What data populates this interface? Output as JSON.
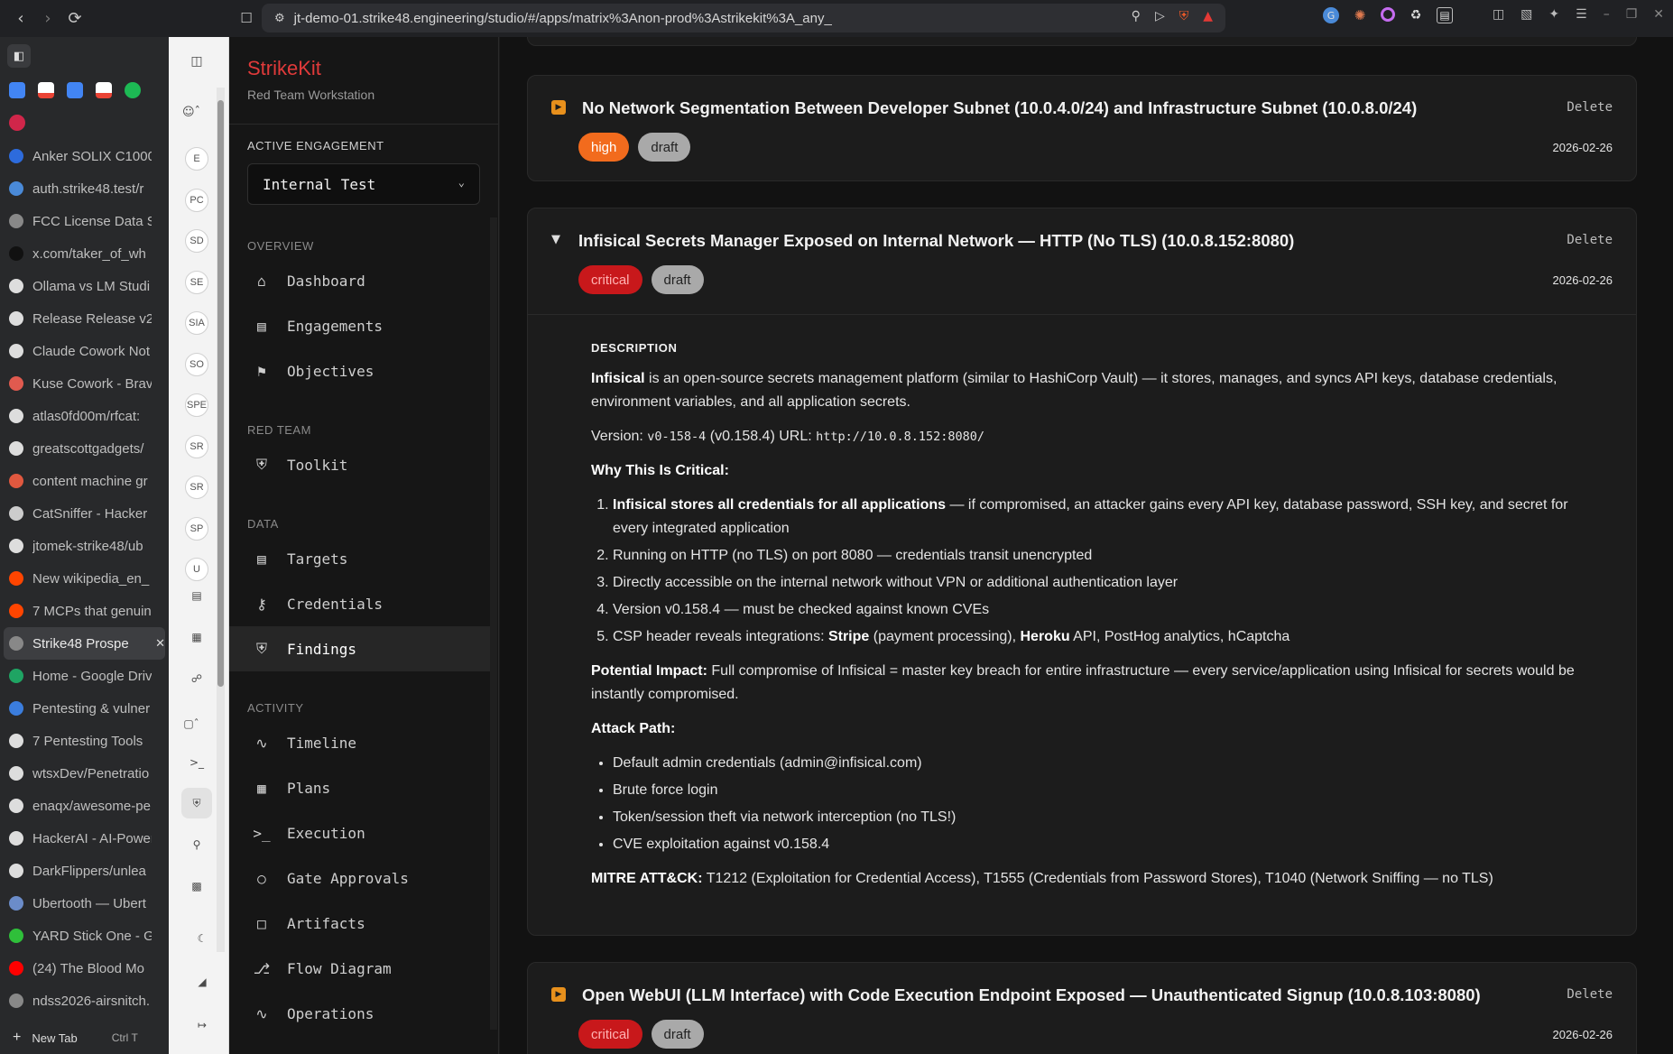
{
  "browser": {
    "url": "jt-demo-01.strike48.engineering/studio/#/apps/matrix%3Anon-prod%3Astrikekit%3A_any_",
    "new_tab_label": "New Tab",
    "new_tab_shortcut": "Ctrl  T"
  },
  "tabs": [
    {
      "label": "Anker SOLIX C1000",
      "color": "#2d6bdc"
    },
    {
      "label": "auth.strike48.test/r",
      "color": "#4a8ad8"
    },
    {
      "label": "FCC License Data Se",
      "color": "#888888"
    },
    {
      "label": "x.com/taker_of_wh",
      "color": "#111111"
    },
    {
      "label": "Ollama vs LM Studi",
      "color": "#dddddd"
    },
    {
      "label": "Release Release v2.",
      "color": "#dddddd"
    },
    {
      "label": "Claude Cowork Not",
      "color": "#dddddd"
    },
    {
      "label": "Kuse Cowork - Brav",
      "color": "#e05a4f"
    },
    {
      "label": "atlas0fd00m/rfcat:",
      "color": "#dddddd"
    },
    {
      "label": "greatscottgadgets/",
      "color": "#dddddd"
    },
    {
      "label": "content machine gr",
      "color": "#e0583f"
    },
    {
      "label": "CatSniffer - Hacker",
      "color": "#cccccc"
    },
    {
      "label": "jtomek-strike48/ub",
      "color": "#dddddd"
    },
    {
      "label": "New wikipedia_en_",
      "color": "#ff4500"
    },
    {
      "label": "7 MCPs that genuin",
      "color": "#ff4500"
    },
    {
      "label": "Strike48 Prospe",
      "color": "#888888",
      "active": true
    },
    {
      "label": "Home - Google Driv",
      "color": "#1fa463"
    },
    {
      "label": "Pentesting & vulner",
      "color": "#3b7ddd"
    },
    {
      "label": "7 Pentesting Tools",
      "color": "#dddddd"
    },
    {
      "label": "wtsxDev/Penetratio",
      "color": "#dddddd"
    },
    {
      "label": "enaqx/awesome-pe",
      "color": "#dddddd"
    },
    {
      "label": "HackerAI - AI-Power",
      "color": "#dddddd"
    },
    {
      "label": "DarkFlippers/unlea",
      "color": "#dddddd"
    },
    {
      "label": "Ubertooth — Ubert",
      "color": "#6b8cc9"
    },
    {
      "label": "YARD Stick One - Gr",
      "color": "#2fbf3a"
    },
    {
      "label": "(24) The Blood Mo",
      "color": "#ff0000"
    },
    {
      "label": "ndss2026-airsnitch.",
      "color": "#888888"
    }
  ],
  "rail": {
    "avatars": [
      "E",
      "PC",
      "SD",
      "SE",
      "SIA",
      "SO",
      "SPE",
      "SR",
      "SR",
      "SP",
      "U"
    ]
  },
  "app": {
    "brand": "StrikeKit",
    "subtitle": "Red Team Workstation",
    "active_engagement_label": "ACTIVE ENGAGEMENT",
    "active_engagement_value": "Internal Test",
    "sections": {
      "overview": "OVERVIEW",
      "red_team": "RED TEAM",
      "data": "DATA",
      "activity": "ACTIVITY"
    },
    "nav": {
      "dashboard": "Dashboard",
      "engagements": "Engagements",
      "objectives": "Objectives",
      "toolkit": "Toolkit",
      "targets": "Targets",
      "credentials": "Credentials",
      "findings": "Findings",
      "timeline": "Timeline",
      "plans": "Plans",
      "execution": "Execution",
      "gate_approvals": "Gate Approvals",
      "artifacts": "Artifacts",
      "flow_diagram": "Flow Diagram",
      "operations": "Operations"
    }
  },
  "findings": [
    {
      "title": "No Network Segmentation Between Developer Subnet (10.0.4.0/24) and Infrastructure Subnet (10.0.8.0/24)",
      "severity": "high",
      "status": "draft",
      "date": "2026-02-26",
      "delete_label": "Delete"
    },
    {
      "title": "Infisical Secrets Manager Exposed on Internal Network — HTTP (No TLS) (10.0.8.152:8080)",
      "severity": "critical",
      "status": "draft",
      "date": "2026-02-26",
      "delete_label": "Delete",
      "description_label": "DESCRIPTION",
      "intro_bold": "Infisical",
      "intro_rest": " is an open-source secrets management platform (similar to HashiCorp Vault) — it stores, manages, and syncs API keys, database credentials, environment variables, and all application secrets.",
      "version_label": "Version: ",
      "version_code": "v0-158-4",
      "version_mid": " (v0.158.4) URL: ",
      "url_code": "http://10.0.8.152:8080/",
      "why_heading": "Why This Is Critical:",
      "why_1_bold": "Infisical stores all credentials for all applications",
      "why_1_rest": " — if compromised, an attacker gains every API key, database password, SSH key, and secret for every integrated application",
      "why_2": "Running on HTTP (no TLS) on port 8080 — credentials transit unencrypted",
      "why_3": "Directly accessible on the internal network without VPN or additional authentication layer",
      "why_4": "Version v0.158.4 — must be checked against known CVEs",
      "why_5_a": "CSP header reveals integrations: ",
      "why_5_stripe": "Stripe",
      "why_5_b": " (payment processing), ",
      "why_5_heroku": "Heroku",
      "why_5_c": " API, PostHog analytics, hCaptcha",
      "impact_label": "Potential Impact:",
      "impact_text": " Full compromise of Infisical = master key breach for entire infrastructure — every service/application using Infisical for secrets would be instantly compromised.",
      "attack_heading": "Attack Path:",
      "attack_1": "Default admin credentials (admin@infisical.com)",
      "attack_2": "Brute force login",
      "attack_3": "Token/session theft via network interception (no TLS!)",
      "attack_4": "CVE exploitation against v0.158.4",
      "mitre_label": "MITRE ATT&CK:",
      "mitre_text": " T1212 (Exploitation for Credential Access), T1555 (Credentials from Password Stores), T1040 (Network Sniffing — no TLS)"
    },
    {
      "title": "Open WebUI (LLM Interface) with Code Execution Endpoint Exposed — Unauthenticated Signup (10.0.8.103:8080)",
      "severity": "critical",
      "status": "draft",
      "date": "2026-02-26",
      "delete_label": "Delete"
    }
  ]
}
